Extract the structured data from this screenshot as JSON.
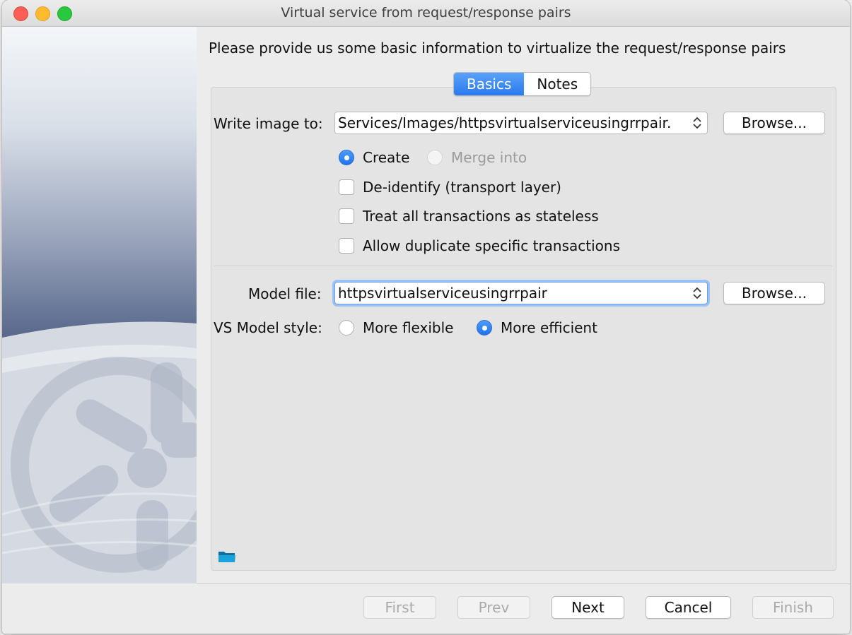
{
  "window": {
    "title": "Virtual service from request/response pairs"
  },
  "instructions": "Please provide us some basic information to virtualize the request/response pairs",
  "tabs": [
    {
      "label": "Basics",
      "active": true
    },
    {
      "label": "Notes",
      "active": false
    }
  ],
  "write_image": {
    "label": "Write image to:",
    "value": "Services/Images/httpsvirtualserviceusingrrpair.",
    "browse_label": "Browse..."
  },
  "image_mode": {
    "create_label": "Create",
    "create_selected": true,
    "merge_label": "Merge into",
    "merge_enabled": false
  },
  "checkboxes": [
    {
      "label": "De-identify (transport layer)",
      "checked": false
    },
    {
      "label": "Treat all transactions as stateless",
      "checked": false
    },
    {
      "label": "Allow duplicate specific transactions",
      "checked": false
    }
  ],
  "model_file": {
    "label": "Model file:",
    "value": "httpsvirtualserviceusingrrpair",
    "browse_label": "Browse..."
  },
  "model_style": {
    "label": "VS Model style:",
    "flexible_label": "More flexible",
    "efficient_label": "More efficient",
    "selected": "More efficient"
  },
  "footer": {
    "first": "First",
    "prev": "Prev",
    "next": "Next",
    "cancel": "Cancel",
    "finish": "Finish"
  },
  "colors": {
    "accent": "#2b79ee",
    "disabled_text": "#a9a9a9"
  },
  "icons": [
    "folder-icon",
    "stepper-icon"
  ]
}
